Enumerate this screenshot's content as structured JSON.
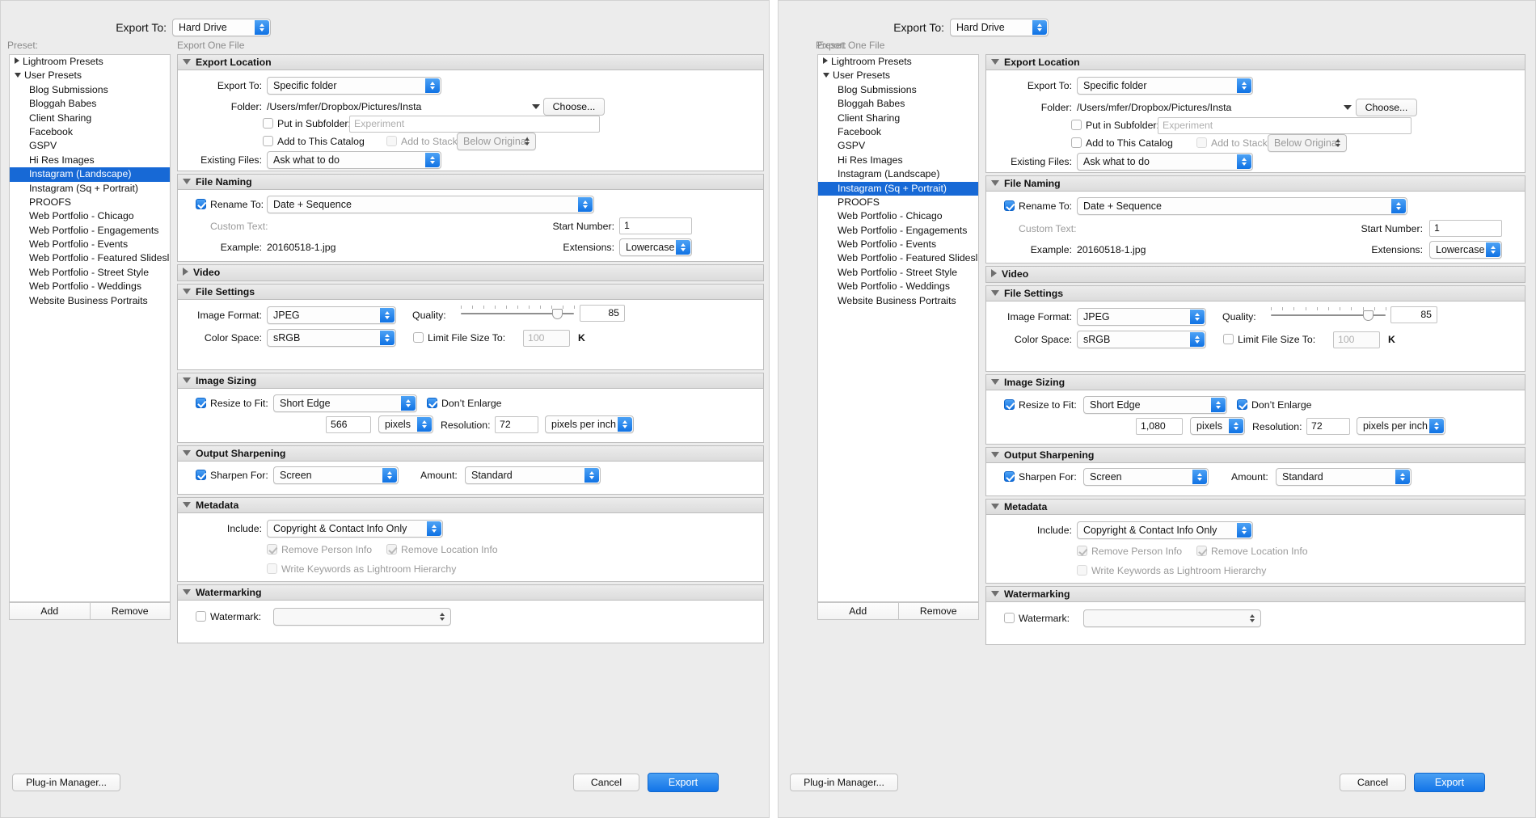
{
  "accent": "#1769d6",
  "export_button_color": "#2080ee",
  "panels": [
    {
      "id": "left",
      "topbar": {
        "label": "Export To:",
        "value": "Hard Drive"
      },
      "preset_label": "Preset:",
      "one_file": "Export One File",
      "preset_items": [
        {
          "label": "Lightroom Presets",
          "type": "group",
          "expanded": false,
          "selected": false
        },
        {
          "label": "User Presets",
          "type": "group",
          "expanded": true,
          "selected": false
        },
        {
          "label": "Blog Submissions",
          "type": "child",
          "selected": false
        },
        {
          "label": "Bloggah Babes",
          "type": "child",
          "selected": false
        },
        {
          "label": "Client Sharing",
          "type": "child",
          "selected": false
        },
        {
          "label": "Facebook",
          "type": "child",
          "selected": false
        },
        {
          "label": "GSPV",
          "type": "child",
          "selected": false
        },
        {
          "label": "Hi Res Images",
          "type": "child",
          "selected": false
        },
        {
          "label": "Instagram (Landscape)",
          "type": "child",
          "selected": true
        },
        {
          "label": "Instagram (Sq + Portrait)",
          "type": "child",
          "selected": false
        },
        {
          "label": "PROOFS",
          "type": "child",
          "selected": false
        },
        {
          "label": "Web Portfolio - Chicago",
          "type": "child",
          "selected": false
        },
        {
          "label": "Web Portfolio - Engagements",
          "type": "child",
          "selected": false
        },
        {
          "label": "Web Portfolio - Events",
          "type": "child",
          "selected": false
        },
        {
          "label": "Web Portfolio - Featured Slidesl",
          "type": "child",
          "selected": false
        },
        {
          "label": "Web Portfolio - Street Style",
          "type": "child",
          "selected": false
        },
        {
          "label": "Web Portfolio - Weddings",
          "type": "child",
          "selected": false
        },
        {
          "label": "Website Business Portraits",
          "type": "child",
          "selected": false
        }
      ],
      "preset_add": "Add",
      "preset_remove": "Remove",
      "export_location": {
        "title": "Export Location",
        "export_to_label": "Export To:",
        "export_to_value": "Specific folder",
        "folder_label": "Folder:",
        "folder_value": "/Users/mfer/Dropbox/Pictures/Insta",
        "choose_label": "Choose...",
        "put_in_subfolder_label": "Put in Subfolder:",
        "subfolder_placeholder": "Experiment",
        "add_to_catalog_label": "Add to This Catalog",
        "add_to_stack_label": "Add to Stack:",
        "add_to_stack_value": "Below Original",
        "existing_files_label": "Existing Files:",
        "existing_files_value": "Ask what to do"
      },
      "file_naming": {
        "title": "File Naming",
        "rename_to_label": "Rename To:",
        "rename_to_value": "Date + Sequence",
        "custom_text_label": "Custom Text:",
        "start_number_label": "Start Number:",
        "start_number_value": "1",
        "example_label": "Example:",
        "example_value": "20160518-1.jpg",
        "extensions_label": "Extensions:",
        "extensions_value": "Lowercase"
      },
      "video": {
        "title": "Video"
      },
      "file_settings": {
        "title": "File Settings",
        "image_format_label": "Image Format:",
        "image_format_value": "JPEG",
        "color_space_label": "Color Space:",
        "color_space_value": "sRGB",
        "quality_label": "Quality:",
        "quality_value": "85",
        "limit_file_size_label": "Limit File Size To:",
        "limit_file_size_value": "100",
        "limit_unit": "K"
      },
      "image_sizing": {
        "title": "Image Sizing",
        "resize_to_fit_label": "Resize to Fit:",
        "resize_to_fit_value": "Short Edge",
        "dont_enlarge_label": "Don’t Enlarge",
        "size_value": "566",
        "size_unit": "pixels",
        "resolution_label": "Resolution:",
        "resolution_value": "72",
        "resolution_unit": "pixels per inch"
      },
      "output_sharpening": {
        "title": "Output Sharpening",
        "sharpen_for_label": "Sharpen For:",
        "sharpen_for_value": "Screen",
        "amount_label": "Amount:",
        "amount_value": "Standard"
      },
      "metadata": {
        "title": "Metadata",
        "include_label": "Include:",
        "include_value": "Copyright & Contact Info Only",
        "remove_person_label": "Remove Person Info",
        "remove_location_label": "Remove Location Info",
        "write_keywords_label": "Write Keywords as Lightroom Hierarchy"
      },
      "watermarking": {
        "title": "Watermarking",
        "watermark_label": "Watermark:",
        "watermark_value": ""
      },
      "bottom": {
        "plugin_manager": "Plug-in Manager...",
        "cancel": "Cancel",
        "export": "Export"
      }
    },
    {
      "id": "right",
      "topbar": {
        "label": "Export To:",
        "value": "Hard Drive"
      },
      "preset_label": "Preset:",
      "one_file": "Export One File",
      "preset_items": [
        {
          "label": "Lightroom Presets",
          "type": "group",
          "expanded": false,
          "selected": false
        },
        {
          "label": "User Presets",
          "type": "group",
          "expanded": true,
          "selected": false
        },
        {
          "label": "Blog Submissions",
          "type": "child",
          "selected": false
        },
        {
          "label": "Bloggah Babes",
          "type": "child",
          "selected": false
        },
        {
          "label": "Client Sharing",
          "type": "child",
          "selected": false
        },
        {
          "label": "Facebook",
          "type": "child",
          "selected": false
        },
        {
          "label": "GSPV",
          "type": "child",
          "selected": false
        },
        {
          "label": "Hi Res Images",
          "type": "child",
          "selected": false
        },
        {
          "label": "Instagram (Landscape)",
          "type": "child",
          "selected": false
        },
        {
          "label": "Instagram (Sq + Portrait)",
          "type": "child",
          "selected": true
        },
        {
          "label": "PROOFS",
          "type": "child",
          "selected": false
        },
        {
          "label": "Web Portfolio - Chicago",
          "type": "child",
          "selected": false
        },
        {
          "label": "Web Portfolio - Engagements",
          "type": "child",
          "selected": false
        },
        {
          "label": "Web Portfolio - Events",
          "type": "child",
          "selected": false
        },
        {
          "label": "Web Portfolio - Featured Slidesl",
          "type": "child",
          "selected": false
        },
        {
          "label": "Web Portfolio - Street Style",
          "type": "child",
          "selected": false
        },
        {
          "label": "Web Portfolio - Weddings",
          "type": "child",
          "selected": false
        },
        {
          "label": "Website Business Portraits",
          "type": "child",
          "selected": false
        }
      ],
      "preset_add": "Add",
      "preset_remove": "Remove",
      "export_location": {
        "title": "Export Location",
        "export_to_label": "Export To:",
        "export_to_value": "Specific folder",
        "folder_label": "Folder:",
        "folder_value": "/Users/mfer/Dropbox/Pictures/Insta",
        "choose_label": "Choose...",
        "put_in_subfolder_label": "Put in Subfolder:",
        "subfolder_placeholder": "Experiment",
        "add_to_catalog_label": "Add to This Catalog",
        "add_to_stack_label": "Add to Stack:",
        "add_to_stack_value": "Below Original",
        "existing_files_label": "Existing Files:",
        "existing_files_value": "Ask what to do"
      },
      "file_naming": {
        "title": "File Naming",
        "rename_to_label": "Rename To:",
        "rename_to_value": "Date + Sequence",
        "custom_text_label": "Custom Text:",
        "start_number_label": "Start Number:",
        "start_number_value": "1",
        "example_label": "Example:",
        "example_value": "20160518-1.jpg",
        "extensions_label": "Extensions:",
        "extensions_value": "Lowercase"
      },
      "video": {
        "title": "Video"
      },
      "file_settings": {
        "title": "File Settings",
        "image_format_label": "Image Format:",
        "image_format_value": "JPEG",
        "color_space_label": "Color Space:",
        "color_space_value": "sRGB",
        "quality_label": "Quality:",
        "quality_value": "85",
        "limit_file_size_label": "Limit File Size To:",
        "limit_file_size_value": "100",
        "limit_unit": "K"
      },
      "image_sizing": {
        "title": "Image Sizing",
        "resize_to_fit_label": "Resize to Fit:",
        "resize_to_fit_value": "Short Edge",
        "dont_enlarge_label": "Don’t Enlarge",
        "size_value": "1,080",
        "size_unit": "pixels",
        "resolution_label": "Resolution:",
        "resolution_value": "72",
        "resolution_unit": "pixels per inch"
      },
      "output_sharpening": {
        "title": "Output Sharpening",
        "sharpen_for_label": "Sharpen For:",
        "sharpen_for_value": "Screen",
        "amount_label": "Amount:",
        "amount_value": "Standard"
      },
      "metadata": {
        "title": "Metadata",
        "include_label": "Include:",
        "include_value": "Copyright & Contact Info Only",
        "remove_person_label": "Remove Person Info",
        "remove_location_label": "Remove Location Info",
        "write_keywords_label": "Write Keywords as Lightroom Hierarchy"
      },
      "watermarking": {
        "title": "Watermarking",
        "watermark_label": "Watermark:",
        "watermark_value": ""
      },
      "bottom": {
        "plugin_manager": "Plug-in Manager...",
        "cancel": "Cancel",
        "export": "Export"
      }
    }
  ]
}
